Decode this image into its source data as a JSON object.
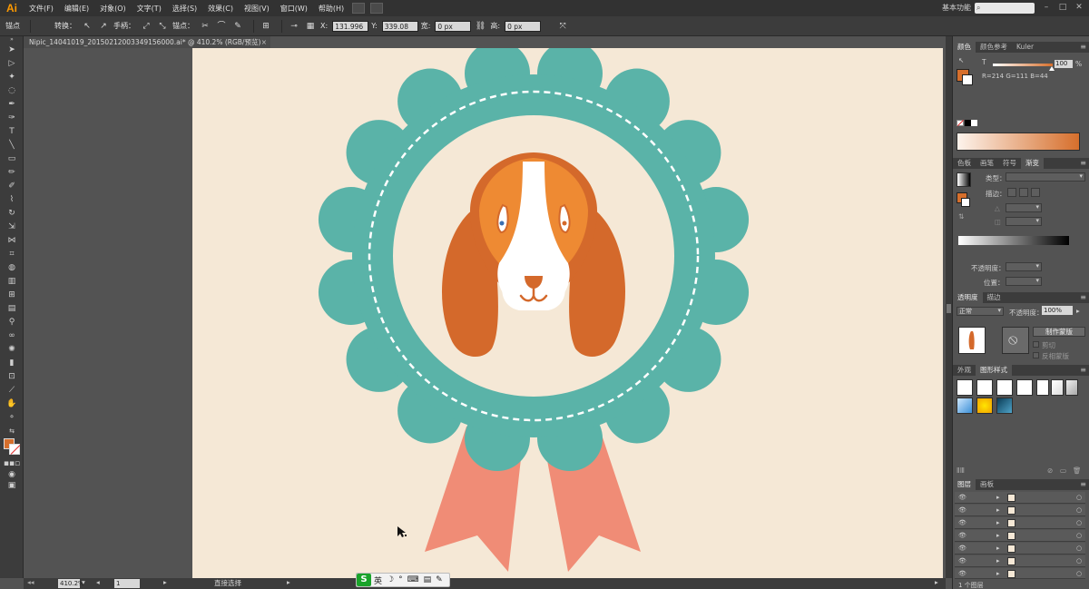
{
  "app": {
    "logo": "Ai",
    "menu": [
      "文件(F)",
      "编辑(E)",
      "对象(O)",
      "文字(T)",
      "选择(S)",
      "效果(C)",
      "视图(V)",
      "窗口(W)",
      "帮助(H)"
    ],
    "workspace": "基本功能",
    "search_icon": "search-icon"
  },
  "controlbar": {
    "anchor_label": "锚点",
    "convert_label": "转换：",
    "handle_label": "手柄：",
    "anchor2_label": "锚点：",
    "x_label": "X:",
    "x_value": "131.996",
    "y_label": "Y:",
    "y_value": "339.08",
    "w_label": "宽:",
    "w_value": "0 px",
    "h_label": "高:",
    "h_value": "0 px"
  },
  "document": {
    "tab_title": "Nipic_14041019_20150212003349156000.ai* @ 410.2% (RGB/预览)",
    "close": "×"
  },
  "statusbar": {
    "zoom": "410.2%",
    "page": "1",
    "tool": "直接选择"
  },
  "ime": {
    "logo": "S",
    "lang": "英",
    "icons": [
      "☽",
      "°",
      "⌨",
      "▤",
      "✎"
    ]
  },
  "color_panel": {
    "tabs": [
      "颜色",
      "颜色参考",
      "Kuler"
    ],
    "t_label": "T",
    "slider_value": "100",
    "percent": "%",
    "rgb_readout": "R=214 G=111 B=44",
    "fill_color": "#d66f2c",
    "ramp_start": "#fdf3ec",
    "ramp_end": "#d66f2c"
  },
  "gradient_panel": {
    "tabs": [
      "色板",
      "画笔",
      "符号",
      "渐变"
    ],
    "type_label": "类型：",
    "stroke_label": "描边：",
    "opacity_label": "不透明度：",
    "position_label": "位置："
  },
  "transparency_panel": {
    "tabs": [
      "透明度",
      "描边"
    ],
    "mode": "正常",
    "opacity_label": "不透明度：",
    "opacity_value": "100%",
    "make_mask": "制作蒙版",
    "clip": "剪切",
    "invert": "反相蒙版"
  },
  "graphic_styles_panel": {
    "tabs": [
      "外观",
      "图形样式"
    ]
  },
  "layers_panel": {
    "tabs": [
      "图层",
      "画板"
    ],
    "count": "1 个图层"
  },
  "artwork": {
    "teal": "#5ab3a8",
    "ribbon": "#f08c76",
    "cream": "#f5e8d6",
    "orange_dark": "#d4692b",
    "orange_light": "#ee8a33",
    "white": "#ffffff"
  }
}
